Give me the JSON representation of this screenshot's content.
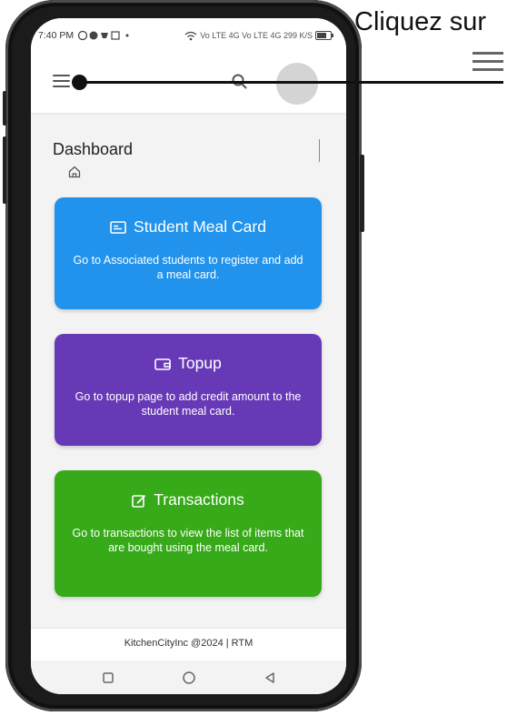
{
  "status_bar": {
    "time": "7:40 PM",
    "network_info": "Vo LTE 4G Vo LTE 4G 299 K/S"
  },
  "app_bar": {
    "menu_icon": "hamburger-menu-icon",
    "search_icon": "search-icon"
  },
  "page": {
    "title": "Dashboard",
    "breadcrumb_icon": "home-icon"
  },
  "cards": [
    {
      "icon": "id-card-icon",
      "title": "Student Meal Card",
      "description": "Go to Associated students to register and add a meal card.",
      "color": "#2193ec"
    },
    {
      "icon": "wallet-icon",
      "title": "Topup",
      "description": "Go to topup page to add credit amount to the student meal card.",
      "color": "#6739b7"
    },
    {
      "icon": "edit-icon",
      "title": "Transactions",
      "description": "Go to transactions to view the list of items that are bought using the meal card.",
      "color": "#36aa18"
    }
  ],
  "footer": {
    "text": "KitchenCityInc @2024 | RTM"
  },
  "callout": {
    "text": "Cliquez sur",
    "icon": "hamburger-menu-icon"
  }
}
